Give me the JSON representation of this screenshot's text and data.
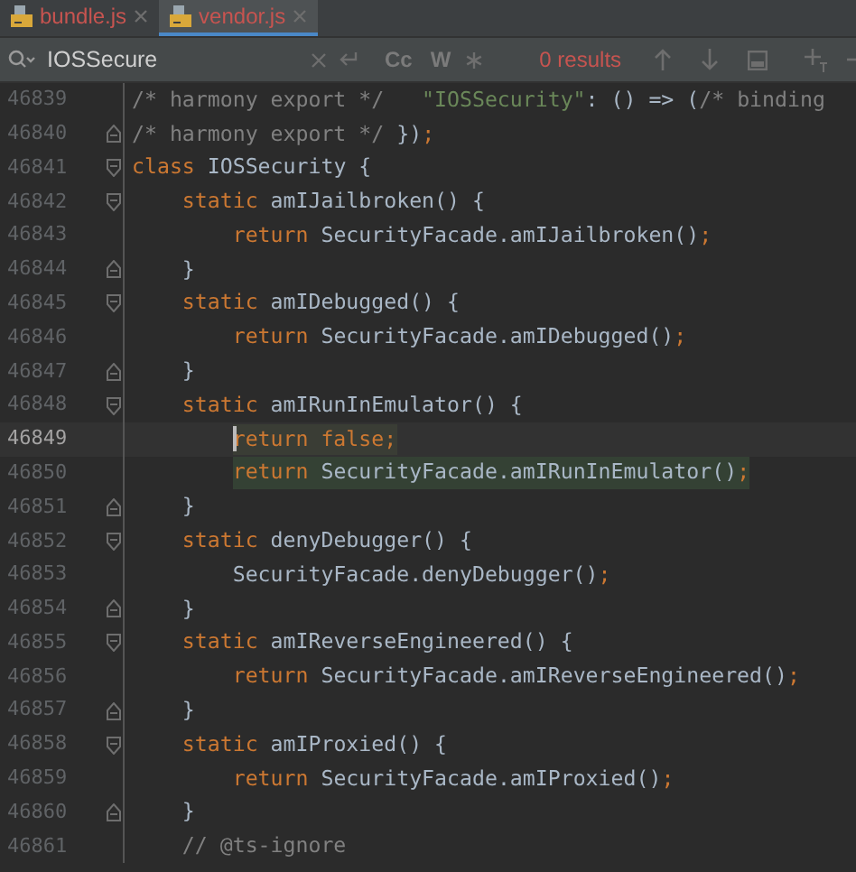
{
  "tabs": [
    {
      "label": "bundle.js",
      "selected": false
    },
    {
      "label": "vendor.js",
      "selected": true
    }
  ],
  "search": {
    "value": "IOSSecure",
    "options": [
      "Cc",
      "W"
    ],
    "results": "0 results"
  },
  "lines": [
    {
      "number": "46839",
      "fold_start": false,
      "fold_end": false,
      "current": false,
      "highlight": false,
      "tokens": [
        {
          "kind": "comment",
          "text": "/* harmony export */   "
        },
        {
          "kind": "string",
          "text": "\"IOSSecurity\""
        },
        {
          "kind": "plain",
          "text": ": () => ("
        },
        {
          "kind": "comment",
          "text": "/* binding"
        }
      ]
    },
    {
      "number": "46840",
      "fold_start": false,
      "fold_end": true,
      "current": false,
      "highlight": false,
      "tokens": [
        {
          "kind": "comment",
          "text": "/* harmony export */ "
        },
        {
          "kind": "plain",
          "text": "})"
        },
        {
          "kind": "punct",
          "text": ";"
        }
      ]
    },
    {
      "number": "46841",
      "fold_start": true,
      "fold_end": false,
      "current": false,
      "highlight": false,
      "tokens": [
        {
          "kind": "keyword",
          "text": "class "
        },
        {
          "kind": "plain",
          "text": "IOSSecurity {"
        }
      ]
    },
    {
      "number": "46842",
      "fold_start": true,
      "fold_end": false,
      "current": false,
      "highlight": false,
      "tokens": [
        {
          "kind": "keyword",
          "text": "    static "
        },
        {
          "kind": "plain",
          "text": "amIJailbroken() {"
        }
      ]
    },
    {
      "number": "46843",
      "fold_start": false,
      "fold_end": false,
      "current": false,
      "highlight": false,
      "tokens": [
        {
          "kind": "keyword",
          "text": "        return "
        },
        {
          "kind": "plain",
          "text": "SecurityFacade.amIJailbroken()"
        },
        {
          "kind": "punct",
          "text": ";"
        }
      ]
    },
    {
      "number": "46844",
      "fold_start": false,
      "fold_end": true,
      "current": false,
      "highlight": false,
      "tokens": [
        {
          "kind": "plain",
          "text": "    }"
        }
      ]
    },
    {
      "number": "46845",
      "fold_start": true,
      "fold_end": false,
      "current": false,
      "highlight": false,
      "tokens": [
        {
          "kind": "keyword",
          "text": "    static "
        },
        {
          "kind": "plain",
          "text": "amIDebugged() {"
        }
      ]
    },
    {
      "number": "46846",
      "fold_start": false,
      "fold_end": false,
      "current": false,
      "highlight": false,
      "tokens": [
        {
          "kind": "keyword",
          "text": "        return "
        },
        {
          "kind": "plain",
          "text": "SecurityFacade.amIDebugged()"
        },
        {
          "kind": "punct",
          "text": ";"
        }
      ]
    },
    {
      "number": "46847",
      "fold_start": false,
      "fold_end": true,
      "current": false,
      "highlight": false,
      "tokens": [
        {
          "kind": "plain",
          "text": "    }"
        }
      ]
    },
    {
      "number": "46848",
      "fold_start": true,
      "fold_end": false,
      "current": false,
      "highlight": false,
      "tokens": [
        {
          "kind": "keyword",
          "text": "    static "
        },
        {
          "kind": "plain",
          "text": "amIRunInEmulator() {"
        }
      ]
    },
    {
      "number": "46849",
      "fold_start": false,
      "fold_end": false,
      "current": true,
      "highlight": true,
      "tokens": [
        {
          "kind": "keyword",
          "text": "        return false"
        },
        {
          "kind": "punct",
          "text": ";"
        }
      ]
    },
    {
      "number": "46850",
      "fold_start": false,
      "fold_end": false,
      "current": false,
      "highlight": true,
      "tokens": [
        {
          "kind": "keyword",
          "text": "        return "
        },
        {
          "kind": "plain",
          "text": "SecurityFacade.amIRunInEmulator()"
        },
        {
          "kind": "punct",
          "text": ";"
        }
      ]
    },
    {
      "number": "46851",
      "fold_start": false,
      "fold_end": true,
      "current": false,
      "highlight": false,
      "tokens": [
        {
          "kind": "plain",
          "text": "    }"
        }
      ]
    },
    {
      "number": "46852",
      "fold_start": true,
      "fold_end": false,
      "current": false,
      "highlight": false,
      "tokens": [
        {
          "kind": "keyword",
          "text": "    static "
        },
        {
          "kind": "plain",
          "text": "denyDebugger() {"
        }
      ]
    },
    {
      "number": "46853",
      "fold_start": false,
      "fold_end": false,
      "current": false,
      "highlight": false,
      "tokens": [
        {
          "kind": "plain",
          "text": "        SecurityFacade.denyDebugger()"
        },
        {
          "kind": "punct",
          "text": ";"
        }
      ]
    },
    {
      "number": "46854",
      "fold_start": false,
      "fold_end": true,
      "current": false,
      "highlight": false,
      "tokens": [
        {
          "kind": "plain",
          "text": "    }"
        }
      ]
    },
    {
      "number": "46855",
      "fold_start": true,
      "fold_end": false,
      "current": false,
      "highlight": false,
      "tokens": [
        {
          "kind": "keyword",
          "text": "    static "
        },
        {
          "kind": "plain",
          "text": "amIReverseEngineered() {"
        }
      ]
    },
    {
      "number": "46856",
      "fold_start": false,
      "fold_end": false,
      "current": false,
      "highlight": false,
      "tokens": [
        {
          "kind": "keyword",
          "text": "        return "
        },
        {
          "kind": "plain",
          "text": "SecurityFacade.amIReverseEngineered()"
        },
        {
          "kind": "punct",
          "text": ";"
        }
      ]
    },
    {
      "number": "46857",
      "fold_start": false,
      "fold_end": true,
      "current": false,
      "highlight": false,
      "tokens": [
        {
          "kind": "plain",
          "text": "    }"
        }
      ]
    },
    {
      "number": "46858",
      "fold_start": true,
      "fold_end": false,
      "current": false,
      "highlight": false,
      "tokens": [
        {
          "kind": "keyword",
          "text": "    static "
        },
        {
          "kind": "plain",
          "text": "amIProxied() {"
        }
      ]
    },
    {
      "number": "46859",
      "fold_start": false,
      "fold_end": false,
      "current": false,
      "highlight": false,
      "tokens": [
        {
          "kind": "keyword",
          "text": "        return "
        },
        {
          "kind": "plain",
          "text": "SecurityFacade.amIProxied()"
        },
        {
          "kind": "punct",
          "text": ";"
        }
      ]
    },
    {
      "number": "46860",
      "fold_start": false,
      "fold_end": true,
      "current": false,
      "highlight": false,
      "tokens": [
        {
          "kind": "plain",
          "text": "    }"
        }
      ]
    },
    {
      "number": "46861",
      "fold_start": false,
      "fold_end": false,
      "current": false,
      "highlight": false,
      "tokens": [
        {
          "kind": "comment",
          "text": "    // @ts-ignore"
        }
      ]
    }
  ]
}
